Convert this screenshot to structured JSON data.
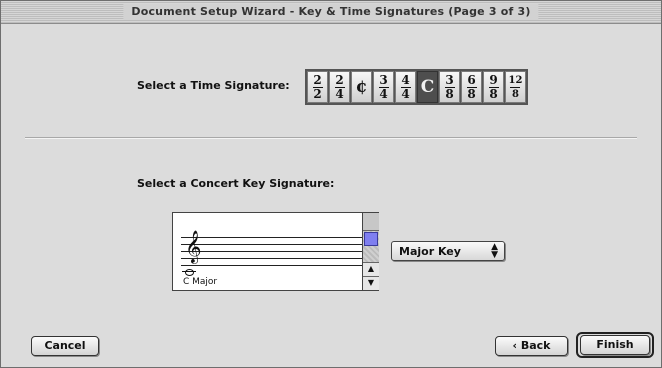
{
  "window": {
    "title": "Document Setup Wizard - Key & Time Signatures (Page 3 of 3)"
  },
  "time_signature": {
    "label": "Select a Time Signature:",
    "options": [
      {
        "top": "2",
        "bottom": "2"
      },
      {
        "top": "2",
        "bottom": "4"
      },
      {
        "symbol": "¢"
      },
      {
        "top": "3",
        "bottom": "4"
      },
      {
        "top": "4",
        "bottom": "4"
      },
      {
        "symbol": "C"
      },
      {
        "top": "3",
        "bottom": "8"
      },
      {
        "top": "6",
        "bottom": "8"
      },
      {
        "top": "9",
        "bottom": "8"
      },
      {
        "top": "12",
        "bottom": "8"
      }
    ],
    "selected_index": 5
  },
  "key_signature": {
    "label": "Select a Concert Key Signature:",
    "current_key": "C Major",
    "mode_dropdown": {
      "value": "Major Key"
    }
  },
  "buttons": {
    "cancel": "Cancel",
    "back": "‹ Back",
    "finish": "Finish"
  },
  "colors": {
    "window_bg": "#dcdcdc",
    "selected_button": "#4e4e4e",
    "scroll_thumb": "#7f7ff0"
  }
}
